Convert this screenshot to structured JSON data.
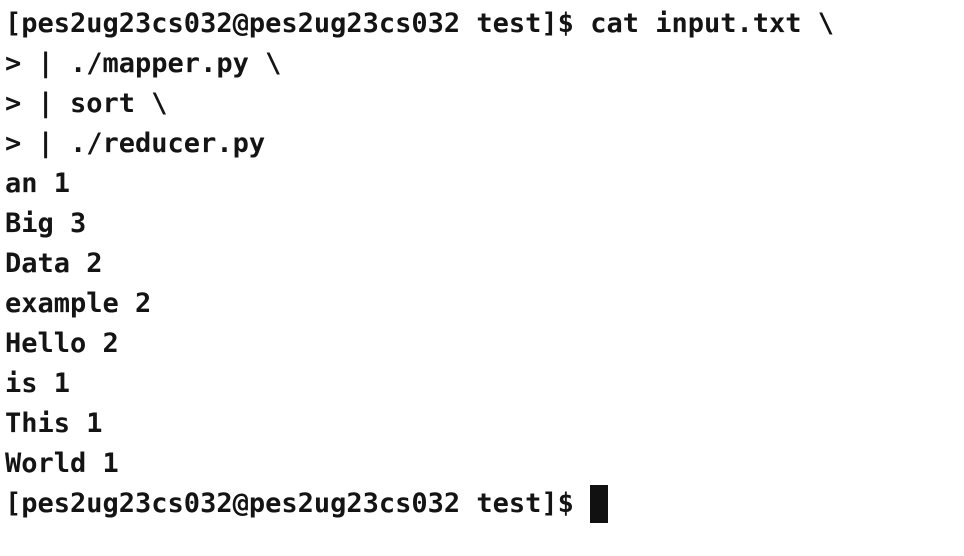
{
  "terminal": {
    "lines": [
      {
        "text": "[pes2ug23cs032@pes2ug23cs032 test]$ cat input.txt \\"
      },
      {
        "text": "> | ./mapper.py \\"
      },
      {
        "text": "> | sort \\"
      },
      {
        "text": "> | ./reducer.py"
      },
      {
        "text": "an 1"
      },
      {
        "text": "Big 3"
      },
      {
        "text": "Data 2"
      },
      {
        "text": "example 2"
      },
      {
        "text": "Hello 2"
      },
      {
        "text": "is 1"
      },
      {
        "text": "This 1"
      },
      {
        "text": "World 1"
      }
    ],
    "prompt": "[pes2ug23cs032@pes2ug23cs032 test]$"
  }
}
